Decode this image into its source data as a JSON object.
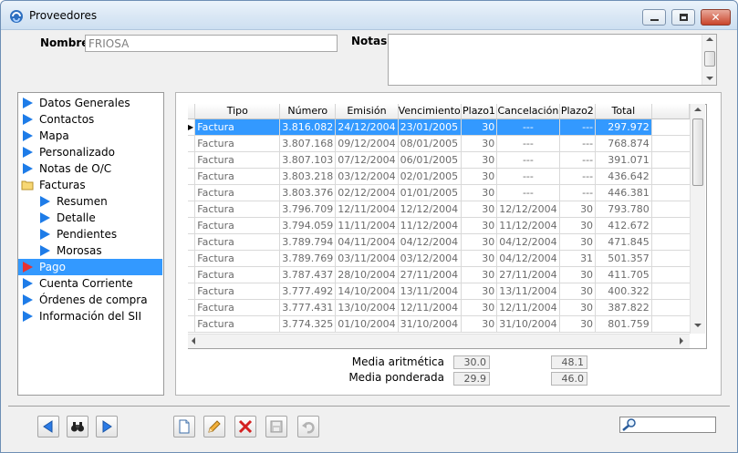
{
  "window": {
    "title": "Proveedores"
  },
  "form": {
    "nombre_label": "Nombre",
    "nombre_value": "FRIOSA",
    "notas_label": "Notas",
    "notas_value": ""
  },
  "nav": {
    "items": [
      {
        "label": "Datos Generales"
      },
      {
        "label": "Contactos"
      },
      {
        "label": "Mapa"
      },
      {
        "label": "Personalizado"
      },
      {
        "label": "Notas de O/C"
      },
      {
        "label": "Facturas"
      },
      {
        "label": "Resumen"
      },
      {
        "label": "Detalle"
      },
      {
        "label": "Pendientes"
      },
      {
        "label": "Morosas"
      },
      {
        "label": "Pago"
      },
      {
        "label": "Cuenta Corriente"
      },
      {
        "label": "Órdenes de compra"
      },
      {
        "label": "Información del SII"
      }
    ]
  },
  "grid": {
    "columns": [
      "Tipo",
      "Número",
      "Emisión",
      "Vencimiento",
      "Plazo1",
      "Cancelación",
      "Plazo2",
      "Total"
    ],
    "rows": [
      [
        "Factura",
        "3.816.082",
        "24/12/2004",
        "23/01/2005",
        "30",
        "---",
        "---",
        "297.972"
      ],
      [
        "Factura",
        "3.807.168",
        "09/12/2004",
        "08/01/2005",
        "30",
        "---",
        "---",
        "768.874"
      ],
      [
        "Factura",
        "3.807.103",
        "07/12/2004",
        "06/01/2005",
        "30",
        "---",
        "---",
        "391.071"
      ],
      [
        "Factura",
        "3.803.218",
        "03/12/2004",
        "02/01/2005",
        "30",
        "---",
        "---",
        "436.642"
      ],
      [
        "Factura",
        "3.803.376",
        "02/12/2004",
        "01/01/2005",
        "30",
        "---",
        "---",
        "446.381"
      ],
      [
        "Factura",
        "3.796.709",
        "12/11/2004",
        "12/12/2004",
        "30",
        "12/12/2004",
        "30",
        "793.780"
      ],
      [
        "Factura",
        "3.794.059",
        "11/11/2004",
        "11/12/2004",
        "30",
        "11/12/2004",
        "30",
        "412.672"
      ],
      [
        "Factura",
        "3.789.794",
        "04/11/2004",
        "04/12/2004",
        "30",
        "04/12/2004",
        "30",
        "471.845"
      ],
      [
        "Factura",
        "3.789.769",
        "03/11/2004",
        "03/12/2004",
        "30",
        "04/12/2004",
        "31",
        "501.357"
      ],
      [
        "Factura",
        "3.787.437",
        "28/10/2004",
        "27/11/2004",
        "30",
        "27/11/2004",
        "30",
        "411.705"
      ],
      [
        "Factura",
        "3.777.492",
        "14/10/2004",
        "13/11/2004",
        "30",
        "13/11/2004",
        "30",
        "400.322"
      ],
      [
        "Factura",
        "3.777.431",
        "13/10/2004",
        "12/11/2004",
        "30",
        "12/11/2004",
        "30",
        "387.822"
      ],
      [
        "Factura",
        "3.774.325",
        "01/10/2004",
        "31/10/2004",
        "30",
        "31/10/2004",
        "30",
        "801.759"
      ]
    ]
  },
  "stats": {
    "aritmetica_label": "Media aritmética",
    "aritmetica_plazo1": "30.0",
    "aritmetica_plazo2": "48.1",
    "ponderada_label": "Media ponderada",
    "ponderada_plazo1": "29.9",
    "ponderada_plazo2": "46.0"
  },
  "colors": {
    "selection": "#3399ff",
    "arrow": "#1e7ce8",
    "arrow_selected": "#e63232"
  }
}
